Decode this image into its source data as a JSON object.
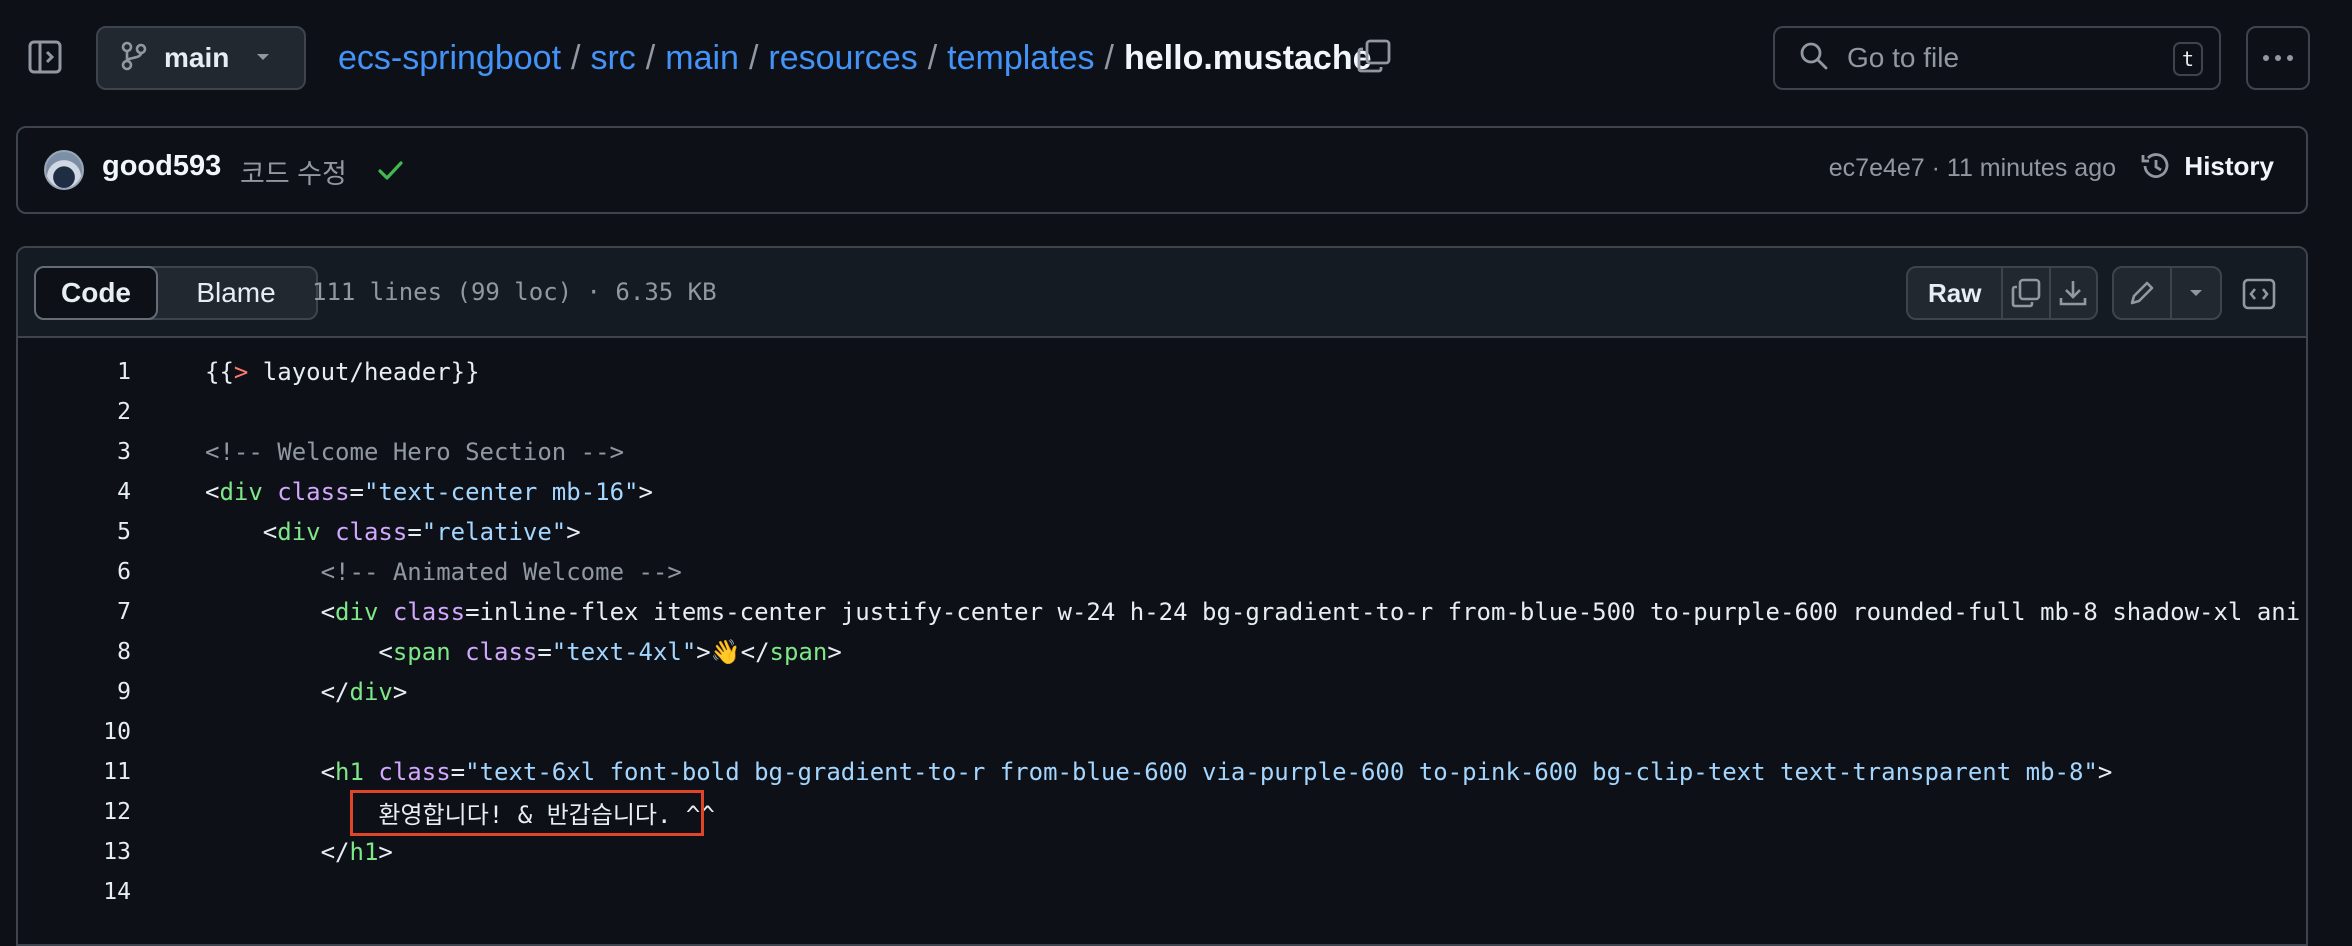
{
  "header": {
    "branch": "main",
    "breadcrumb": [
      {
        "label": "ecs-springboot"
      },
      {
        "label": "src"
      },
      {
        "label": "main"
      },
      {
        "label": "resources"
      },
      {
        "label": "templates"
      }
    ],
    "separator": "/",
    "current_file": "hello.mustache",
    "search_placeholder": "Go to file",
    "search_shortcut": "t"
  },
  "commit": {
    "author": "good593",
    "message": "코드 수정",
    "sha_time": "ec7e4e7 · 11 minutes ago",
    "history_label": "History",
    "status_color": "#3fb950"
  },
  "file": {
    "tabs": [
      "Code",
      "Blame"
    ],
    "active_tab": "Code",
    "info": "111 lines (99 loc) · 6.35 KB",
    "raw_label": "Raw"
  },
  "code_lines": [
    {
      "n": "1",
      "t": "{{> layout/header}}"
    },
    {
      "n": "2",
      "t": ""
    },
    {
      "n": "3",
      "t": "<!-- Welcome Hero Section -->"
    },
    {
      "n": "4",
      "t": "<div class=\"text-center mb-16\">"
    },
    {
      "n": "5",
      "t": "    <div class=\"relative\">"
    },
    {
      "n": "6",
      "t": "        <!-- Animated Welcome -->"
    },
    {
      "n": "7",
      "t": "        <div class=\"inline-flex items-center justify-center w-24 h-24 bg-gradient-to-r from-blue-500 to-purple-600 rounded-full mb-8 shadow-xl ani"
    },
    {
      "n": "8",
      "t": "            <span class=\"text-4xl\">👋</span>"
    },
    {
      "n": "9",
      "t": "        </div>"
    },
    {
      "n": "10",
      "t": ""
    },
    {
      "n": "11",
      "t": "        <h1 class=\"text-6xl font-bold bg-gradient-to-r from-blue-600 via-purple-600 to-pink-600 bg-clip-text text-transparent mb-8\">"
    },
    {
      "n": "12",
      "t": "            환영합니다! & 반갑습니다. ^^"
    },
    {
      "n": "13",
      "t": "        </h1>"
    },
    {
      "n": "14",
      "t": ""
    }
  ],
  "highlight_color": "#e0452a"
}
